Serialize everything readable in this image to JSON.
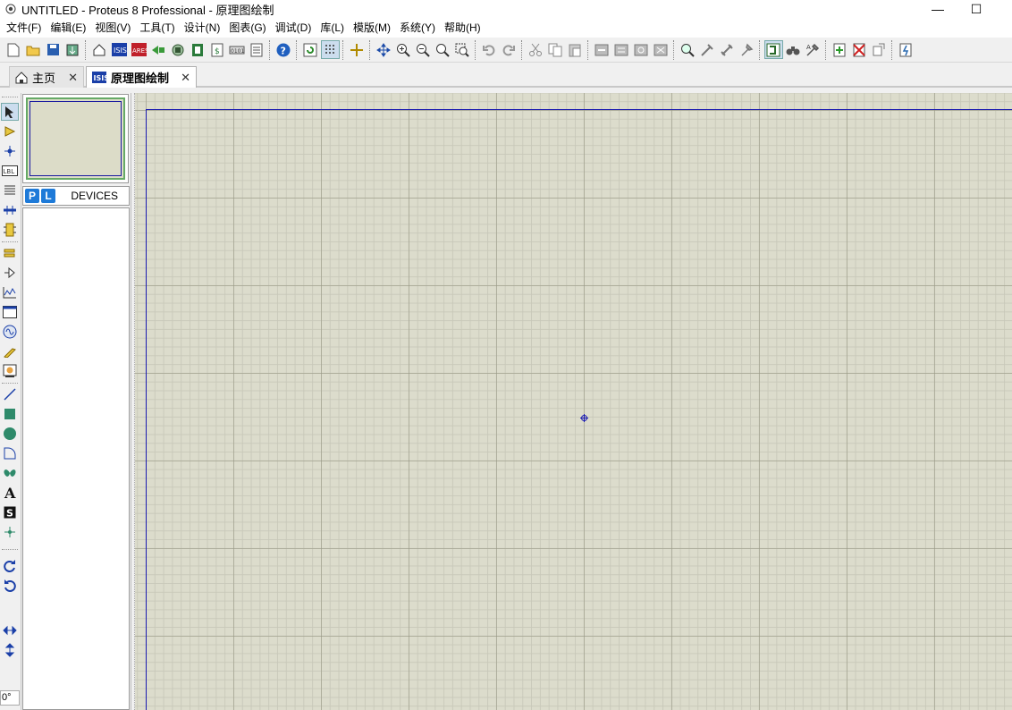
{
  "window": {
    "title": "UNTITLED - Proteus 8 Professional - 原理图绘制",
    "minimize": "—",
    "maximize": "☐"
  },
  "menu": [
    "文件(F)",
    "编辑(E)",
    "视图(V)",
    "工具(T)",
    "设计(N)",
    "图表(G)",
    "调试(D)",
    "库(L)",
    "模版(M)",
    "系统(Y)",
    "帮助(H)"
  ],
  "tabs": [
    {
      "label": "主页",
      "close": "✕"
    },
    {
      "label": "原理图绘制",
      "close": "✕"
    }
  ],
  "side": {
    "p_button": "P",
    "l_button": "L",
    "devices_label": "DEVICES"
  },
  "rotation_angle": "0°",
  "colors": {
    "canvas_bg": "#dcdccc",
    "sheet_border": "#1a1ab0",
    "accent": "#1e7ad8"
  }
}
